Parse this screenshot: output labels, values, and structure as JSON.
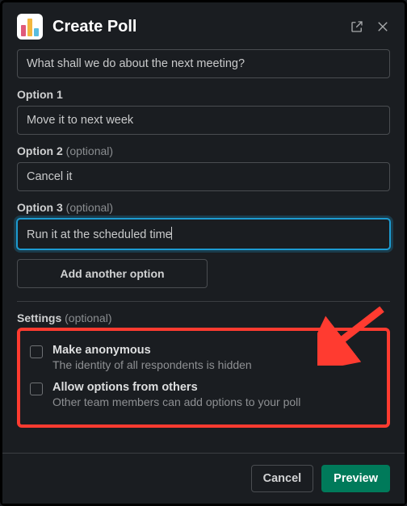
{
  "header": {
    "title": "Create Poll"
  },
  "question": {
    "value": "What shall we do about the next meeting?"
  },
  "options": [
    {
      "label": "Option 1",
      "suffix": "",
      "value": "Move it to next week",
      "focused": false
    },
    {
      "label": "Option 2",
      "suffix": " (optional)",
      "value": "Cancel it",
      "focused": false
    },
    {
      "label": "Option 3",
      "suffix": " (optional)",
      "value": "Run it at the scheduled time",
      "focused": true
    }
  ],
  "addOption": "Add another option",
  "settings": {
    "label": "Settings",
    "suffix": " (optional)",
    "items": [
      {
        "title": "Make anonymous",
        "desc": "The identity of all respondents is hidden",
        "checked": false
      },
      {
        "title": "Allow options from others",
        "desc": "Other team members can add options to your poll",
        "checked": false
      }
    ]
  },
  "footer": {
    "cancel": "Cancel",
    "preview": "Preview"
  }
}
